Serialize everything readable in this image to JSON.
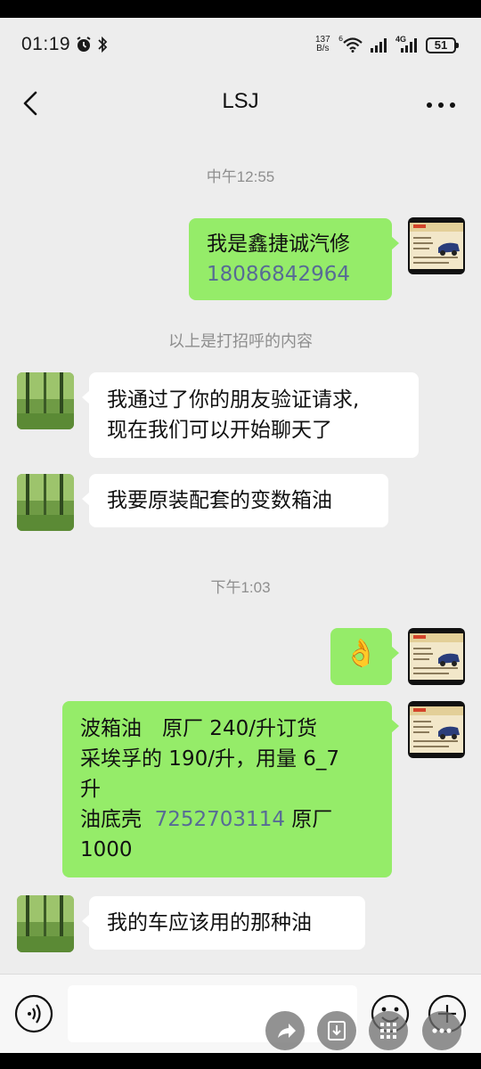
{
  "status_bar": {
    "time": "01:19",
    "net_speed_value": "137",
    "net_speed_unit": "B/s",
    "signal_label_1": "6",
    "signal_label_2": "4G",
    "battery": "51"
  },
  "header": {
    "title": "LSJ"
  },
  "messages": [
    {
      "type": "timestamp",
      "text": "中午12:55"
    },
    {
      "type": "out",
      "line1": "我是鑫捷诚汽修",
      "phone": "18086842964"
    },
    {
      "type": "system",
      "text": "以上是打招呼的内容"
    },
    {
      "type": "in",
      "line1": "我通过了你的朋友验证请求,",
      "line2": "现在我们可以开始聊天了"
    },
    {
      "type": "in",
      "text": "我要原装配套的变数箱油"
    },
    {
      "type": "timestamp",
      "text": "下午1:03"
    },
    {
      "type": "out-emoji",
      "emoji": "👌"
    },
    {
      "type": "out",
      "line1": "波箱油　原厂 240/升订货",
      "line2": "采埃孚的 190/升，用量 6_7",
      "line3": "升",
      "line4_pre": "油底壳  ",
      "line4_link": "7252703114",
      "line4_post": " 原厂",
      "line5": "1000"
    },
    {
      "type": "in",
      "text": "我的车应该用的那种油"
    }
  ],
  "input": {
    "placeholder": ""
  },
  "colors": {
    "out_bubble": "#95ec69",
    "in_bubble": "#ffffff",
    "background": "#ededed",
    "link": "#576b95"
  },
  "icons": {
    "back": "chevron-left-icon",
    "more": "more-dots-icon",
    "voice": "voice-icon",
    "emoji": "emoji-icon",
    "plus": "plus-icon",
    "share": "share-icon",
    "download": "download-icon",
    "grid": "grid-icon",
    "overflow": "more-icon"
  }
}
